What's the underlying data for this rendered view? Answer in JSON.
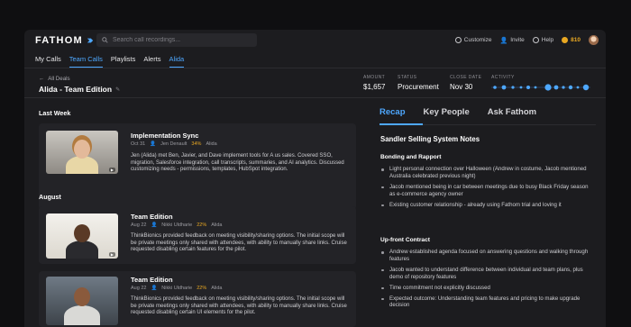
{
  "app": {
    "name": "FATHOM"
  },
  "search": {
    "placeholder": "Search call recordings..."
  },
  "top_actions": {
    "customize": "Customize",
    "invite": "Invite",
    "help": "Help",
    "credits": "810"
  },
  "nav": [
    "My Calls",
    "Team Calls",
    "Playlists",
    "Alerts",
    "Alida"
  ],
  "nav_active": "Alida",
  "header": {
    "back_label": "All Deals",
    "title": "Alida - Team Edition",
    "stats": [
      {
        "label": "AMOUNT",
        "value": "$1,657"
      },
      {
        "label": "STATUS",
        "value": "Procurement"
      },
      {
        "label": "CLOSE DATE",
        "value": "Nov 30"
      }
    ],
    "activity_label": "ACTIVITY"
  },
  "sections": {
    "last_week": "Last Week",
    "august": "August"
  },
  "calls": [
    {
      "title": "Implementation Sync",
      "date": "Oct 31",
      "person": "Jen Denault",
      "pct": "34%",
      "company": "Alida",
      "summary": "Jen (Alida) met Ben, Javier, and Dave implement tools for A us sales.  Covered SSO, migration, Salesforce integration, call transcripts, summaries, and AI analytics. Discussed customizing needs - permissions, templates, HubSpot integration."
    },
    {
      "title": "Team Edition",
      "date": "Aug 22",
      "person": "Nikki Uldharie",
      "pct": "22%",
      "company": "Alida",
      "summary": "ThinkBionics provided feedback on meeting visibility/sharing options. The initial scope will be private meetings only shared with attendees, with ability to manually share links. Cruise requested disabling certain features for the pilot."
    },
    {
      "title": "Team Edition",
      "date": "Aug 22",
      "person": "Nikki Uldharie",
      "pct": "22%",
      "company": "Alida",
      "summary": "ThinkBionics provided feedback on meeting visibility/sharing options. The initial scope will be private meetings only shared with attendees, with ability to manually share links. Cruise requested disabling certain UI elements for the pilot."
    }
  ],
  "tabs": [
    "Recap",
    "Key People",
    "Ask Fathom"
  ],
  "notes": {
    "title": "Sandler Selling System Notes",
    "groups": [
      {
        "heading": "Bonding and Rapport",
        "items": [
          "Light personal connection over Halloween (Andrew in costume, Jacob mentioned Australia celebrated previous night)",
          "Jacob mentioned being in car between meetings due to busy Black Friday season as e-commerce agency owner",
          "Existing customer relationship - already using Fathom trial and loving it"
        ]
      },
      {
        "heading": "Up-front Contract",
        "items": [
          "Andrew established agenda focused on answering questions and walking through features",
          "Jacob wanted to understand difference between individual and team plans, plus demo of repository features",
          "Time commitment not explicitly discussed",
          "Expected outcome: Understanding team features and pricing to make upgrade decision"
        ]
      }
    ]
  },
  "colors": {
    "accent": "#4ea8ff",
    "gold": "#e9a822",
    "panel": "#1c1c1f",
    "card": "#232327"
  }
}
